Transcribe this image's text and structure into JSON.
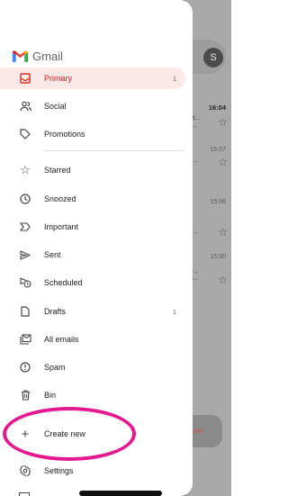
{
  "app": {
    "name": "Gmail"
  },
  "background": {
    "avatar_initial": "S",
    "rows": [
      {
        "time": "16:04",
        "bold": true,
        "snippet": "et...\nr...",
        "star": true
      },
      {
        "time": "15:07",
        "bold": false,
        "snippet": "ll...",
        "star": true
      },
      {
        "time": "15:06",
        "bold": false,
        "snippet": "ll...",
        "star": true
      },
      {
        "time": "15:00",
        "bold": false,
        "snippet": "e...\na...",
        "star": true
      }
    ],
    "compose_partial": "ose"
  },
  "drawer": {
    "items": [
      {
        "label": "Primary",
        "count": "1",
        "active": true,
        "icon": "inbox-icon"
      },
      {
        "label": "Social",
        "count": "",
        "icon": "people-icon"
      },
      {
        "label": "Promotions",
        "count": "",
        "icon": "tag-icon"
      },
      {
        "label": "Starred",
        "count": "",
        "icon": "star-icon"
      },
      {
        "label": "Snoozed",
        "count": "",
        "icon": "clock-icon"
      },
      {
        "label": "Important",
        "count": "",
        "icon": "important-icon"
      },
      {
        "label": "Sent",
        "count": "",
        "icon": "send-icon"
      },
      {
        "label": "Scheduled",
        "count": "",
        "icon": "scheduled-send-icon"
      },
      {
        "label": "Drafts",
        "count": "1",
        "icon": "draft-icon"
      },
      {
        "label": "All emails",
        "count": "",
        "icon": "all-mail-icon"
      },
      {
        "label": "Spam",
        "count": "",
        "icon": "spam-icon"
      },
      {
        "label": "Bin",
        "count": "",
        "icon": "trash-icon"
      },
      {
        "label": "Create new",
        "count": "",
        "icon": "plus-icon"
      },
      {
        "label": "Settings",
        "count": "",
        "icon": "settings-icon"
      }
    ]
  },
  "colors": {
    "accent_red": "#c5221f",
    "active_bg": "#fce8e6",
    "highlight_circle": "#e2198f"
  }
}
